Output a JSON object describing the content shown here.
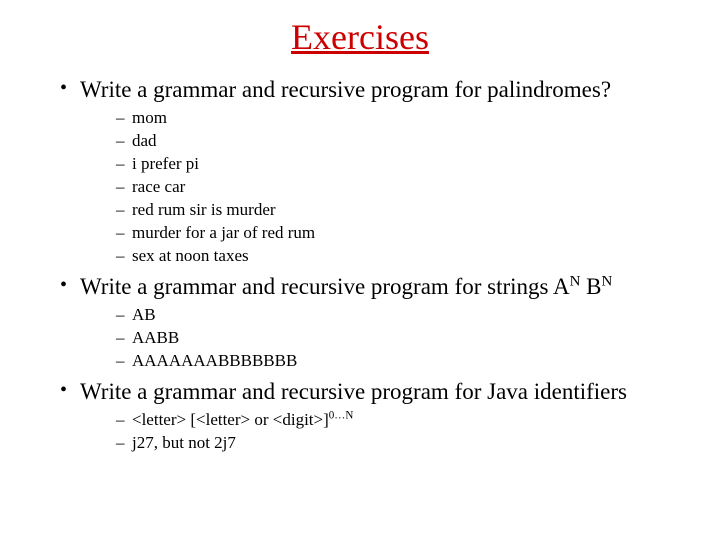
{
  "title": "Exercises",
  "bullets": {
    "b1": {
      "text": "Write a grammar and recursive program for palindromes?",
      "sub": [
        "mom",
        "dad",
        "i prefer pi",
        "race car",
        "red rum sir is murder",
        "murder for a jar of red rum",
        "sex at noon taxes"
      ]
    },
    "b2": {
      "prefix": "Write a grammar and recursive program for strings A",
      "sup1": "N",
      "mid": " B",
      "sup2": "N",
      "sub": [
        "AB",
        "AABB",
        "AAAAAAABBBBBBB"
      ]
    },
    "b3": {
      "text": "Write a grammar and recursive program for Java identifiers",
      "sub_rich": {
        "prefix": "<letter> [<letter> or <digit>]",
        "sup": "0…N"
      },
      "sub_plain": "j27, but not 2j7"
    }
  }
}
